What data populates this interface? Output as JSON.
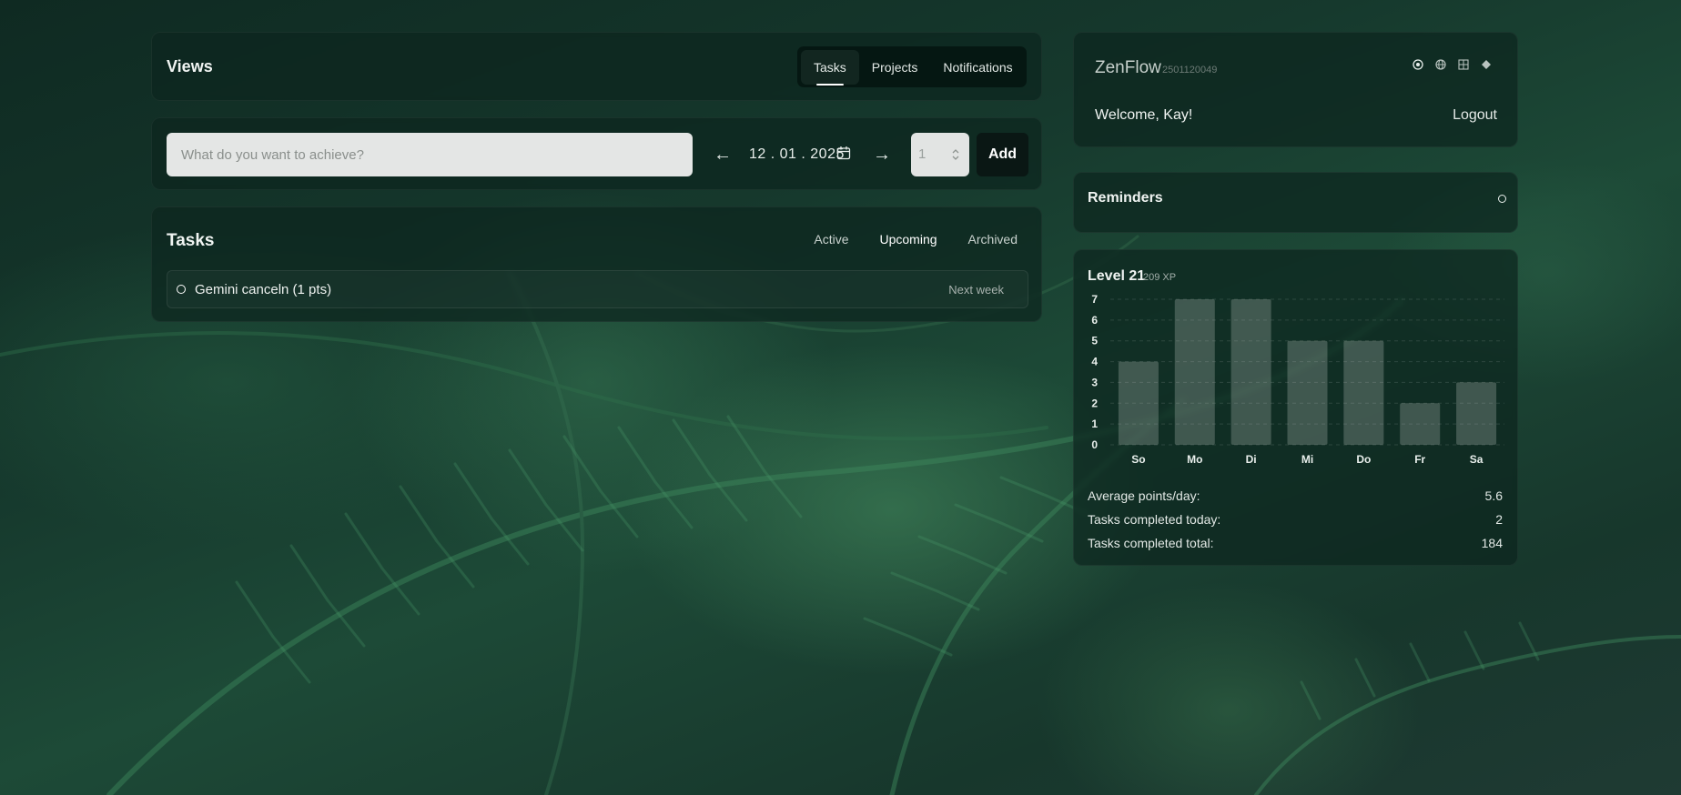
{
  "views": {
    "title": "Views",
    "tabs": [
      {
        "label": "Tasks",
        "active": true
      },
      {
        "label": "Projects",
        "active": false
      },
      {
        "label": "Notifications",
        "active": false
      }
    ]
  },
  "entry": {
    "placeholder": "What do you want to achieve?",
    "prev_icon": "arrow-left-icon",
    "date": "12 . 01 . 2025",
    "calendar_icon": "calendar-icon",
    "next_icon": "arrow-right-icon",
    "points_value": "1",
    "add_label": "Add"
  },
  "tasks": {
    "title": "Tasks",
    "filters": [
      {
        "label": "Active",
        "active": false
      },
      {
        "label": "Upcoming",
        "active": true
      },
      {
        "label": "Archived",
        "active": false
      }
    ],
    "items": [
      {
        "label": "Gemini canceln (1 pts)",
        "due": "Next week"
      }
    ]
  },
  "account": {
    "brand": "ZenFlow",
    "build": "2501120049",
    "theme_icons": [
      "target-icon",
      "globe-icon",
      "grid-icon",
      "diamond-icon"
    ],
    "welcome": "Welcome, Kay!",
    "logout": "Logout"
  },
  "reminders": {
    "title": "Reminders"
  },
  "stats": {
    "level": "Level 21",
    "xp": "209 XP",
    "rows": [
      {
        "label": "Average points/day:",
        "value": "5.6"
      },
      {
        "label": "Tasks completed today:",
        "value": "2"
      },
      {
        "label": "Tasks completed total:",
        "value": "184"
      }
    ]
  },
  "chart_data": {
    "type": "bar",
    "categories": [
      "So",
      "Mo",
      "Di",
      "Mi",
      "Do",
      "Fr",
      "Sa"
    ],
    "values": [
      4,
      7,
      7,
      5,
      5,
      2,
      3
    ],
    "ylim": [
      0,
      7
    ],
    "yticks": [
      "0",
      "1",
      "2",
      "3",
      "4",
      "5",
      "6",
      "7"
    ],
    "grid": true,
    "title": "",
    "xlabel": "",
    "ylabel": ""
  }
}
